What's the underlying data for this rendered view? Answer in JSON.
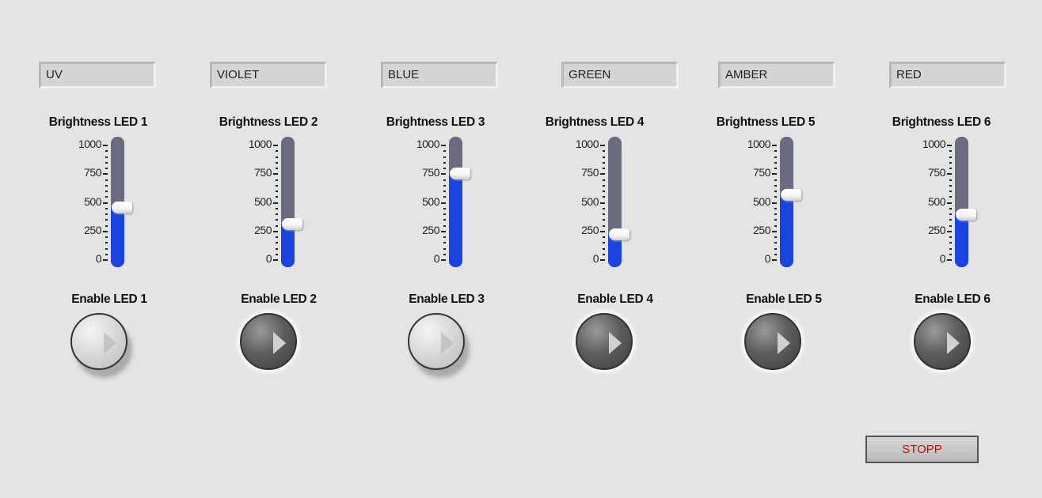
{
  "slider_scale": {
    "min": 0,
    "max": 1000,
    "ticks": [
      "1000",
      "750",
      "500",
      "250",
      "0"
    ]
  },
  "channels": [
    {
      "name": "UV",
      "brightness_label": "Brightness LED 1",
      "brightness": 455,
      "enable_label": "Enable LED 1",
      "enabled": true
    },
    {
      "name": "VIOLET",
      "brightness_label": "Brightness LED 2",
      "brightness": 310,
      "enable_label": "Enable LED 2",
      "enabled": false
    },
    {
      "name": "BLUE",
      "brightness_label": "Brightness LED 3",
      "brightness": 750,
      "enable_label": "Enable LED 3",
      "enabled": true
    },
    {
      "name": "GREEN",
      "brightness_label": "Brightness LED 4",
      "brightness": 220,
      "enable_label": "Enable LED 4",
      "enabled": false
    },
    {
      "name": "AMBER",
      "brightness_label": "Brightness LED 5",
      "brightness": 565,
      "enable_label": "Enable LED 5",
      "enabled": false
    },
    {
      "name": "RED",
      "brightness_label": "Brightness LED 6",
      "brightness": 393,
      "enable_label": "Enable LED 6",
      "enabled": false
    }
  ],
  "stop_button": {
    "label": "STOPP",
    "color": "#e00000"
  },
  "colors": {
    "fill": "#1a44e0",
    "track": "#6b6b80",
    "background": "#e4e4e4"
  }
}
